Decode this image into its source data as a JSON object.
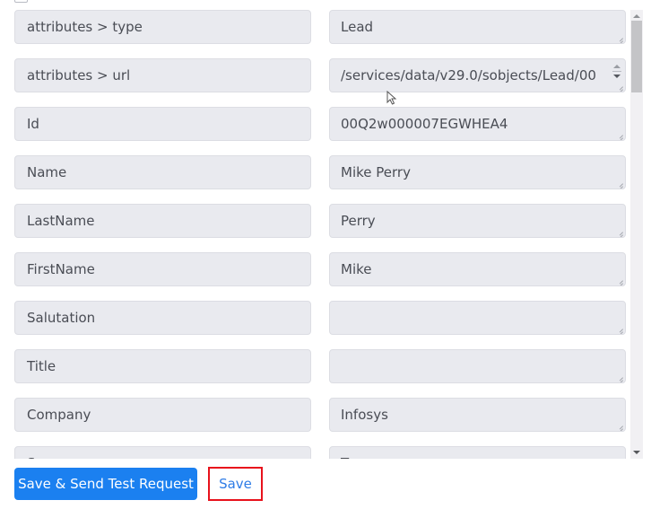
{
  "fields": [
    {
      "key": "attributes > type",
      "value": "Lead",
      "has_spinner": false
    },
    {
      "key": "attributes > url",
      "value": "/services/data/v29.0/sobjects/Lead/00",
      "has_spinner": true
    },
    {
      "key": "Id",
      "value": "00Q2w000007EGWHEA4",
      "has_spinner": false
    },
    {
      "key": "Name",
      "value": "Mike Perry",
      "has_spinner": false
    },
    {
      "key": "LastName",
      "value": "Perry",
      "has_spinner": false
    },
    {
      "key": "FirstName",
      "value": "Mike",
      "has_spinner": false
    },
    {
      "key": "Salutation",
      "value": "",
      "has_spinner": false
    },
    {
      "key": "Title",
      "value": "",
      "has_spinner": false
    },
    {
      "key": "Company",
      "value": "Infosys",
      "has_spinner": false
    },
    {
      "key": "S...",
      "value": "T...",
      "has_spinner": false
    }
  ],
  "buttons": {
    "save_and_send_label": "Save & Send Test Request",
    "save_label": "Save"
  },
  "colors": {
    "primary_button": "#1b80f0",
    "save_text": "#2e7ce6",
    "highlight_border": "#e8121c",
    "field_background": "#e9eaef"
  }
}
